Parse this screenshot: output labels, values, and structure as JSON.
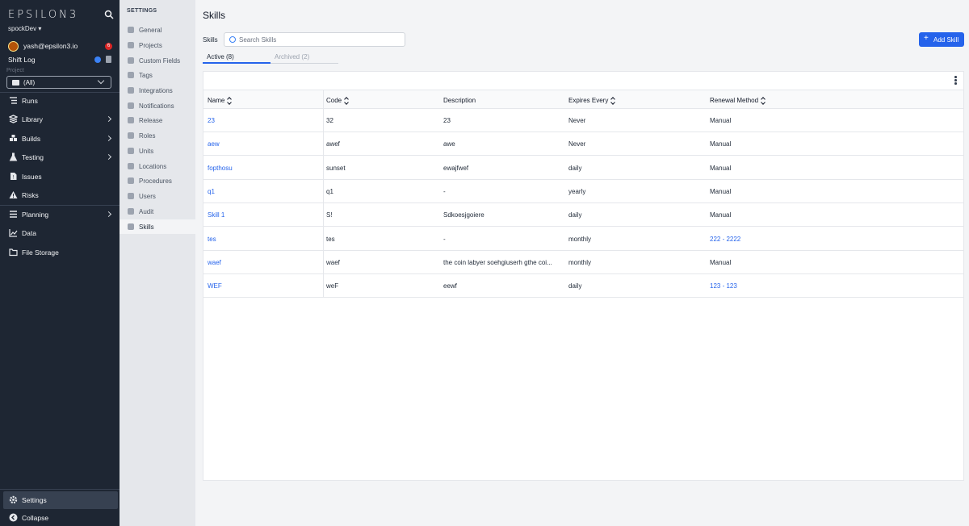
{
  "app": {
    "logo": "EPSILON3",
    "workspace": "spockDev",
    "user_email": "yash@epsilon3.io",
    "notification_count": "6",
    "shift_log": "Shift Log",
    "project_label": "Project",
    "project_value": "(All)"
  },
  "nav": {
    "items": [
      {
        "label": "Runs"
      },
      {
        "label": "Library"
      },
      {
        "label": "Builds"
      },
      {
        "label": "Testing"
      },
      {
        "label": "Issues"
      },
      {
        "label": "Risks"
      },
      {
        "label": "Planning"
      },
      {
        "label": "Data"
      },
      {
        "label": "File Storage"
      }
    ],
    "settings": "Settings",
    "collapse": "Collapse"
  },
  "settings_nav": {
    "title": "SETTINGS",
    "items": [
      {
        "label": "General"
      },
      {
        "label": "Projects"
      },
      {
        "label": "Custom Fields"
      },
      {
        "label": "Tags"
      },
      {
        "label": "Integrations"
      },
      {
        "label": "Notifications"
      },
      {
        "label": "Release"
      },
      {
        "label": "Roles"
      },
      {
        "label": "Units"
      },
      {
        "label": "Locations"
      },
      {
        "label": "Procedures"
      },
      {
        "label": "Users"
      },
      {
        "label": "Audit"
      },
      {
        "label": "Skills"
      }
    ]
  },
  "main": {
    "title": "Skills",
    "skills_label": "Skills",
    "search_placeholder": "Search Skills",
    "add_button": "Add Skill",
    "tabs": [
      {
        "label": "Active (8)"
      },
      {
        "label": "Archived (2)"
      }
    ],
    "columns": [
      {
        "label": "Name"
      },
      {
        "label": "Code"
      },
      {
        "label": "Description"
      },
      {
        "label": "Expires Every"
      },
      {
        "label": "Renewal Method"
      }
    ],
    "rows": [
      {
        "name": "23",
        "code": "32",
        "description": "23",
        "expires": "Never",
        "renewal": "Manual"
      },
      {
        "name": "aew",
        "code": "awef",
        "description": "awe",
        "expires": "Never",
        "renewal": "Manual"
      },
      {
        "name": "fopthosu",
        "code": "sunset",
        "description": "ewajfwef",
        "expires": "daily",
        "renewal": "Manual"
      },
      {
        "name": "q1",
        "code": "q1",
        "description": "-",
        "expires": "yearly",
        "renewal": "Manual"
      },
      {
        "name": "Skill 1",
        "code": "S!",
        "description": "Sdkoesjgoiere",
        "expires": "daily",
        "renewal": "Manual"
      },
      {
        "name": "tes",
        "code": "tes",
        "description": "-",
        "expires": "monthly",
        "renewal": "222 - 2222"
      },
      {
        "name": "waef",
        "code": "waef",
        "description": "the coin labyer soehgiuserh gthe coi...",
        "expires": "monthly",
        "renewal": "Manual"
      },
      {
        "name": "WEF",
        "code": "weF",
        "description": "eewf",
        "expires": "daily",
        "renewal": "123 - 123"
      }
    ]
  }
}
